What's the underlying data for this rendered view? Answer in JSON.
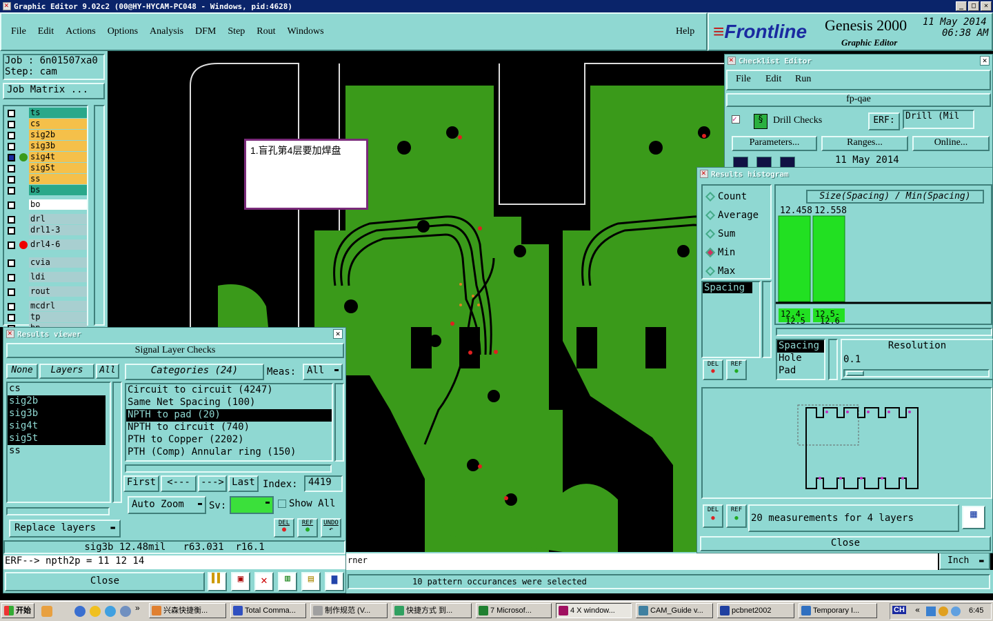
{
  "window": {
    "title": "Graphic Editor 9.02c2 (00@HY-HYCAM-PC048 - Windows, pid:4628)"
  },
  "menu": {
    "items": [
      "File",
      "Edit",
      "Actions",
      "Options",
      "Analysis",
      "DFM",
      "Step",
      "Rout",
      "Windows"
    ],
    "help": "Help"
  },
  "brand": {
    "logo": "Frontline",
    "product": "Genesis 2000",
    "subtitle": "Graphic Editor",
    "date": "11 May 2014",
    "time": "06:38 AM"
  },
  "job": {
    "job_label": "Job : 6n01507xa0",
    "step_label": "Step: cam",
    "matrix_button": "Job Matrix ..."
  },
  "layers": [
    {
      "name": "ts",
      "color": "#2aa88a"
    },
    {
      "name": "cs",
      "color": "#f5c04a"
    },
    {
      "name": "sig2b",
      "color": "#f5c04a"
    },
    {
      "name": "sig3b",
      "color": "#f5c04a"
    },
    {
      "name": "sig4t",
      "color": "#f5c04a"
    },
    {
      "name": "sig5t",
      "color": "#f5c04a"
    },
    {
      "name": "ss",
      "color": "#f5c04a"
    },
    {
      "name": "bs",
      "color": "#2aa88a"
    },
    {
      "name": "bo",
      "color": "#ffffff"
    },
    {
      "name": "drl",
      "color": "#a8cfd0"
    },
    {
      "name": "drl1-3",
      "color": "#a8cfd0"
    },
    {
      "name": "drl4-6",
      "color": "#a8cfd0"
    },
    {
      "name": "cvia",
      "color": "#a8cfd0"
    },
    {
      "name": "ldi",
      "color": "#a8cfd0"
    },
    {
      "name": "rout",
      "color": "#a8cfd0"
    },
    {
      "name": "mcdrl",
      "color": "#a8cfd0"
    },
    {
      "name": "tp",
      "color": "#a8cfd0"
    },
    {
      "name": "bp",
      "color": "#a8cfd0"
    }
  ],
  "note": {
    "text": "1.盲孔第4层要加焊盘"
  },
  "results_viewer": {
    "title": "Results viewer",
    "header": "Signal Layer Checks",
    "none_btn": "None",
    "layers_label": "Layers",
    "all_btn": "All",
    "layer_list": [
      "cs",
      "sig2b",
      "sig3b",
      "sig4t",
      "sig5t",
      "ss"
    ],
    "replace_btn": "Replace layers",
    "categories_label": "Categories (24)",
    "meas_label": "Meas:",
    "meas_value": "All",
    "categories": [
      "Circuit to circuit (4247)",
      "Same Net Spacing (100)",
      "NPTH to pad (20)",
      "NPTH to circuit (740)",
      "PTH to Copper (2202)",
      "PTH (Comp) Annular ring (150)"
    ],
    "first": "First",
    "prev": "<---",
    "next": "--->",
    "last": "Last",
    "index_label": "Index:",
    "index_value": "4419",
    "auto_zoom": "Auto Zoom",
    "sv_label": "Sv:",
    "show_all": "Show All",
    "del": "DEL",
    "ref": "REF",
    "undo": "UNDO",
    "status": "sig3b 12.48mil   r63.031  r16.1",
    "erf": "ERF--> npth2p = 11 12 14",
    "close": "Close"
  },
  "checklist": {
    "title": "Checklist Editor",
    "menu": [
      "File",
      "Edit",
      "Run"
    ],
    "name": "fp-qae",
    "check_name": "Drill Checks",
    "erf_label": "ERF:",
    "erf_value": "Drill (Mil",
    "params_btn": "Parameters...",
    "ranges_btn": "Ranges...",
    "online_btn": "Online...",
    "date": "11 May 2014"
  },
  "histogram": {
    "title": "Results histogram",
    "modes": [
      "Count",
      "Average",
      "Sum",
      "Min",
      "Max"
    ],
    "selected_mode": "Min",
    "type_list_header": "Spacing",
    "chart_title": "Size(Spacing) / Min(Spacing)",
    "bars": [
      {
        "value_label": "12.458",
        "range_top": "12.4-",
        "range_bottom": "12.5"
      },
      {
        "value_label": "12.558",
        "range_top": "12.5-",
        "range_bottom": "12.6"
      }
    ],
    "attrs": [
      "Spacing",
      "Hole",
      "Pad"
    ],
    "resolution_label": "Resolution",
    "resolution_value": "0.1",
    "measurements": "20 measurements for 4 layers",
    "close": "Close"
  },
  "status": {
    "corner_text": "rner",
    "units": "Inch",
    "message": "10 pattern occurances were selected"
  },
  "taskbar": {
    "start": "开始",
    "items": [
      "兴森快捷衡...",
      "Total Comma...",
      "制作规范 (V...",
      "快捷方式 到...",
      "7 Microsof...",
      "4 X window...",
      "CAM_Guide v...",
      "pcbnet2002",
      "Temporary I..."
    ],
    "lang": "CH",
    "clock": "6:45"
  }
}
